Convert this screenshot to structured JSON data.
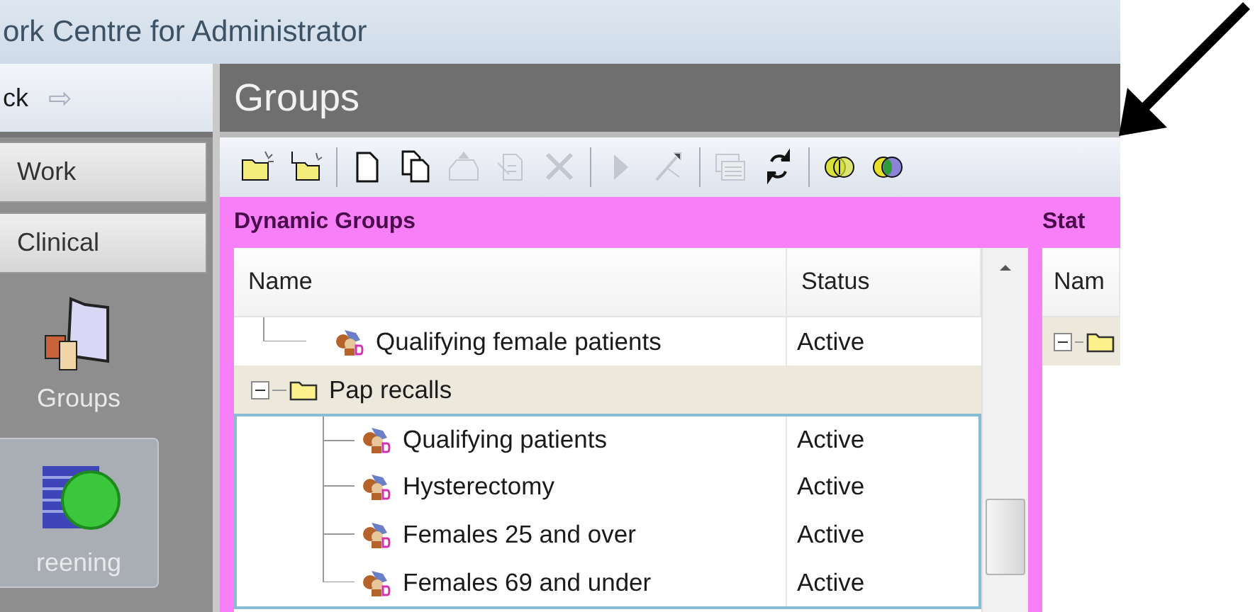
{
  "window": {
    "title": "ork Centre for Administrator"
  },
  "sidebar": {
    "nav": {
      "label": "ck",
      "forward": "⇨"
    },
    "buttons": [
      "Work",
      "Clinical"
    ],
    "items": [
      {
        "label": "Groups",
        "kind": "groups",
        "selected": false
      },
      {
        "label": "reening",
        "kind": "screening",
        "selected": true
      }
    ]
  },
  "header": {
    "title": "Groups"
  },
  "toolbar": [
    {
      "kind": "new-folder",
      "disabled": false
    },
    {
      "kind": "new-subfolder",
      "disabled": false
    },
    {
      "kind": "separator"
    },
    {
      "kind": "new-doc",
      "disabled": false
    },
    {
      "kind": "copy",
      "disabled": false
    },
    {
      "kind": "export",
      "disabled": true
    },
    {
      "kind": "doc-edit",
      "disabled": true
    },
    {
      "kind": "delete",
      "disabled": true
    },
    {
      "kind": "separator"
    },
    {
      "kind": "run",
      "disabled": true
    },
    {
      "kind": "wizard",
      "disabled": true
    },
    {
      "kind": "separator"
    },
    {
      "kind": "window",
      "disabled": true
    },
    {
      "kind": "refresh",
      "disabled": false
    },
    {
      "kind": "separator"
    },
    {
      "kind": "venn",
      "disabled": false
    },
    {
      "kind": "venn-colored",
      "disabled": false
    }
  ],
  "dynamic_groups": {
    "title": "Dynamic Groups",
    "columns": [
      "Name",
      "Status"
    ],
    "rows": [
      {
        "kind": "item",
        "name": "Qualifying female patients",
        "status": "Active"
      },
      {
        "kind": "folder",
        "name": "Pap recalls",
        "selected": true,
        "expanded": true,
        "children": [
          {
            "name": "Qualifying patients",
            "status": "Active"
          },
          {
            "name": "Hysterectomy",
            "status": "Active"
          },
          {
            "name": "Females 25 and over",
            "status": "Active"
          },
          {
            "name": "Females 69 and under",
            "status": "Active"
          }
        ]
      }
    ]
  },
  "static_groups": {
    "title": "Stat",
    "columns": [
      "Nam"
    ],
    "rows": [
      {
        "kind": "folder",
        "expanded": true,
        "selected": true
      }
    ]
  }
}
